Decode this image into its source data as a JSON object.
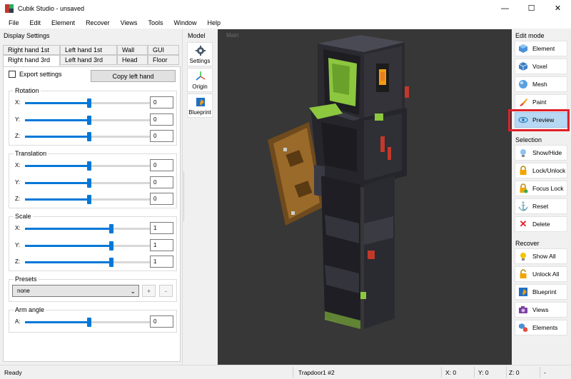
{
  "window": {
    "title": "Cubik Studio - unsaved",
    "minimize": "—",
    "maximize": "☐",
    "close": "✕"
  },
  "menu": [
    "File",
    "Edit",
    "Element",
    "Recover",
    "Views",
    "Tools",
    "Window",
    "Help"
  ],
  "display_settings": {
    "title": "Display Settings",
    "tabs_row1": [
      "Right hand 1st",
      "Left hand 1st",
      "Wall",
      "GUI"
    ],
    "tabs_row2": [
      "Right hand 3rd",
      "Left hand 3rd",
      "Head",
      "Floor"
    ],
    "active_tab": "Right hand 3rd",
    "export_label": "Export settings",
    "export_checked": false,
    "copy_button": "Copy left hand",
    "rotation": {
      "title": "Rotation",
      "sliders": [
        {
          "axis": "X:",
          "value": "0",
          "fraction": 0.5
        },
        {
          "axis": "Y:",
          "value": "0",
          "fraction": 0.5
        },
        {
          "axis": "Z:",
          "value": "0",
          "fraction": 0.5
        }
      ]
    },
    "translation": {
      "title": "Translation",
      "sliders": [
        {
          "axis": "X:",
          "value": "0",
          "fraction": 0.5
        },
        {
          "axis": "Y:",
          "value": "0",
          "fraction": 0.5
        },
        {
          "axis": "Z:",
          "value": "0",
          "fraction": 0.5
        }
      ]
    },
    "scale": {
      "title": "Scale",
      "sliders": [
        {
          "axis": "X:",
          "value": "1",
          "fraction": 0.67
        },
        {
          "axis": "Y:",
          "value": "1",
          "fraction": 0.67
        },
        {
          "axis": "Z:",
          "value": "1",
          "fraction": 0.67
        }
      ]
    },
    "presets": {
      "title": "Presets",
      "selected": "none",
      "add": "+",
      "remove": "-"
    },
    "arm_angle": {
      "title": "Arm angle",
      "axis": "A:",
      "value": "0",
      "fraction": 0.5
    }
  },
  "model": {
    "title": "Model",
    "buttons": [
      "Settings",
      "Origin",
      "Blueprint"
    ]
  },
  "viewport": {
    "label": "Main"
  },
  "edit_mode": {
    "title": "Edit mode",
    "buttons": [
      {
        "label": "Element",
        "icon": "cube-icon"
      },
      {
        "label": "Voxel",
        "icon": "voxel-icon"
      },
      {
        "label": "Mesh",
        "icon": "sphere-icon"
      },
      {
        "label": "Paint",
        "icon": "paint-icon"
      },
      {
        "label": "Preview",
        "icon": "eye-icon",
        "active": true
      }
    ]
  },
  "selection": {
    "title": "Selection",
    "buttons": [
      {
        "label": "Show/Hide",
        "icon": "bulb-icon"
      },
      {
        "label": "Lock/Unlock",
        "icon": "lock-icon"
      },
      {
        "label": "Focus Lock",
        "icon": "focus-lock-icon"
      },
      {
        "label": "Reset",
        "icon": "anchor-icon"
      },
      {
        "label": "Delete",
        "icon": "delete-icon"
      }
    ]
  },
  "recover": {
    "title": "Recover",
    "buttons": [
      {
        "label": "Show All",
        "icon": "bulb-icon"
      },
      {
        "label": "Unlock All",
        "icon": "unlock-icon"
      },
      {
        "label": "Blueprint",
        "icon": "blueprint-icon"
      },
      {
        "label": "Views",
        "icon": "camera-icon"
      },
      {
        "label": "Elements",
        "icon": "elements-icon"
      }
    ]
  },
  "status": {
    "text": "Ready",
    "selection": "Trapdoor1 #2",
    "x": "X: 0",
    "y": "Y: 0",
    "z": "Z: 0",
    "extra": "-"
  },
  "colors": {
    "accent": "#0078d7",
    "active_button": "#b7d7f3",
    "highlight": "#e0202a",
    "viewport_bg": "#373737"
  }
}
